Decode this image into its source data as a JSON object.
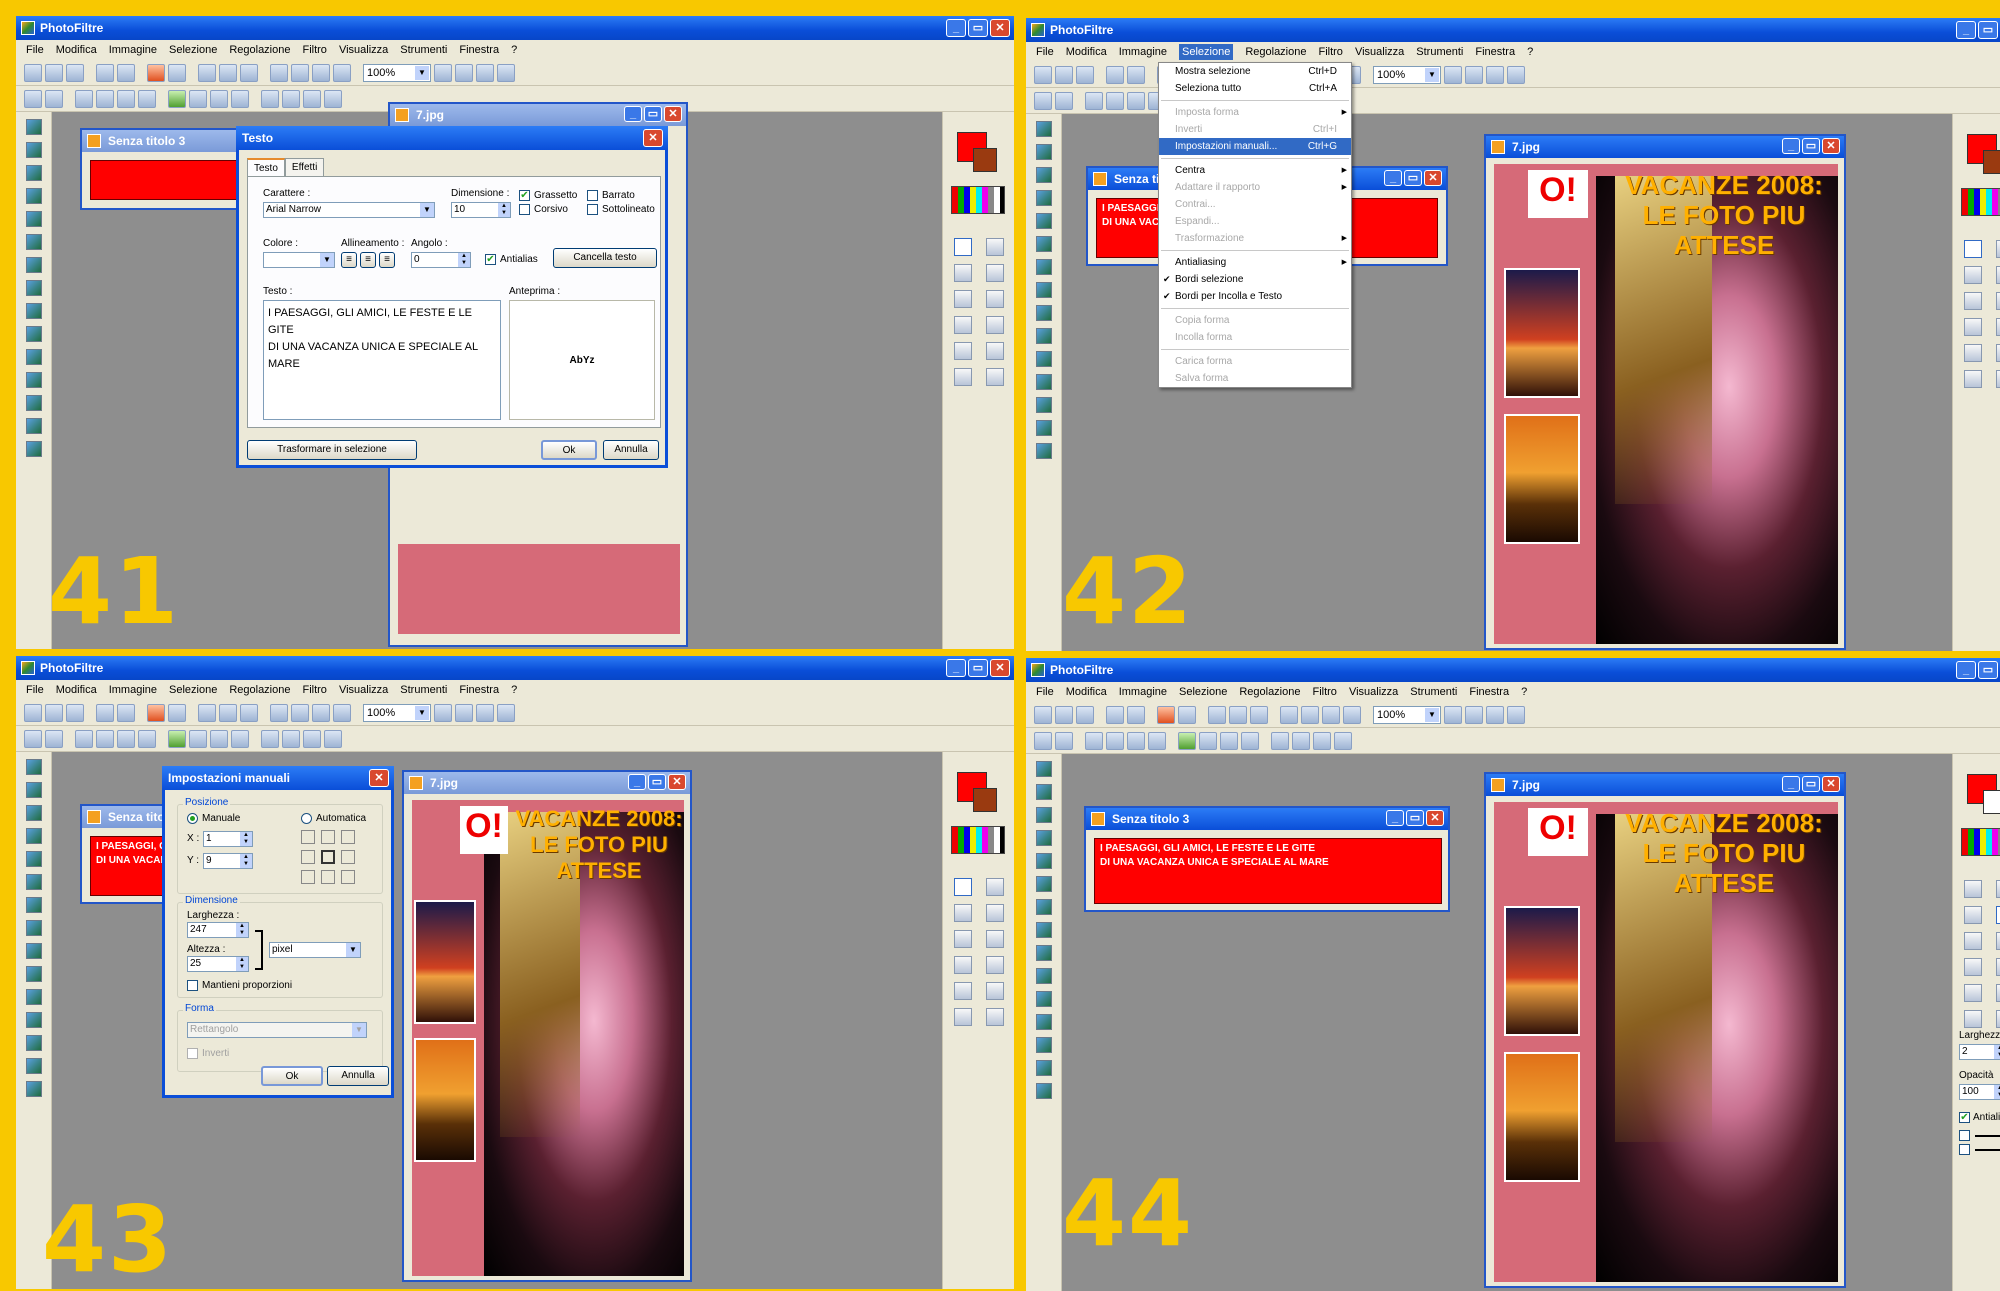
{
  "app": {
    "title": "PhotoFiltre",
    "zoom": "100%"
  },
  "menu": [
    "File",
    "Modifica",
    "Immagine",
    "Selezione",
    "Regolazione",
    "Filtro",
    "Visualizza",
    "Strumenti",
    "Finestra",
    "?"
  ],
  "windows": {
    "image": "7.jpg",
    "untitled": "Senza titolo 3"
  },
  "step_numbers": [
    "41",
    "42",
    "43",
    "44"
  ],
  "image_content": {
    "headline1": "VACANZE 2008:",
    "headline2": "LE FOTO PIU ATTESE",
    "badge": "O!"
  },
  "text_lines": [
    "I PAESAGGI, GLI AMICI, LE FESTE E LE GITE",
    "DI UNA VACANZA UNICA E SPECIALE AL MARE"
  ],
  "truncated_lines": [
    "I PAESAGGI, GLI AMI",
    "DI UNA VACANZA UNI"
  ],
  "truncated_lines_42": [
    "I PAESAGGI",
    "DI UNA VAC"
  ],
  "text_dialog": {
    "title": "Testo",
    "tabs": [
      "Testo",
      "Effetti"
    ],
    "font_label": "Carattere :",
    "font": "Arial Narrow",
    "size_label": "Dimensione :",
    "size": "10",
    "bold": "Grassetto",
    "italic": "Corsivo",
    "strike": "Barrato",
    "underline": "Sottolineato",
    "color_label": "Colore :",
    "align_label": "Allineamento :",
    "angle_label": "Angolo :",
    "angle": "0",
    "antialias": "Antialias",
    "clear": "Cancella testo",
    "text_label": "Testo :",
    "preview_label": "Anteprima :",
    "preview": "AbYz",
    "to_selection": "Trasformare in selezione",
    "ok": "Ok",
    "cancel": "Annulla"
  },
  "selection_menu": [
    {
      "label": "Mostra selezione",
      "shortcut": "Ctrl+D",
      "state": "on"
    },
    {
      "label": "Seleziona tutto",
      "shortcut": "Ctrl+A",
      "state": "on"
    },
    {
      "sep": true
    },
    {
      "label": "Imposta forma",
      "shortcut": "",
      "state": "dis",
      "arrow": true
    },
    {
      "label": "Inverti",
      "shortcut": "Ctrl+I",
      "state": "dis"
    },
    {
      "label": "Impostazioni manuali...",
      "shortcut": "Ctrl+G",
      "state": "hl"
    },
    {
      "sep": true
    },
    {
      "label": "Centra",
      "shortcut": "",
      "state": "on",
      "arrow": true
    },
    {
      "label": "Adattare il rapporto",
      "shortcut": "",
      "state": "dis",
      "arrow": true
    },
    {
      "label": "Contrai...",
      "shortcut": "",
      "state": "dis"
    },
    {
      "label": "Espandi...",
      "shortcut": "",
      "state": "dis"
    },
    {
      "label": "Trasformazione",
      "shortcut": "",
      "state": "dis",
      "arrow": true
    },
    {
      "sep": true
    },
    {
      "label": "Antialiasing",
      "shortcut": "",
      "state": "on",
      "arrow": true
    },
    {
      "label": "Bordi selezione",
      "shortcut": "",
      "state": "chk"
    },
    {
      "label": "Bordi per Incolla e Testo",
      "shortcut": "",
      "state": "chk"
    },
    {
      "sep": true
    },
    {
      "label": "Copia forma",
      "shortcut": "",
      "state": "dis"
    },
    {
      "label": "Incolla forma",
      "shortcut": "",
      "state": "dis"
    },
    {
      "sep": true
    },
    {
      "label": "Carica forma",
      "shortcut": "",
      "state": "dis"
    },
    {
      "label": "Salva forma",
      "shortcut": "",
      "state": "dis"
    }
  ],
  "manual_dialog": {
    "title": "Impostazioni manuali",
    "position": "Posizione",
    "manual": "Manuale",
    "auto": "Automatica",
    "x_label": "X :",
    "x": "1",
    "y_label": "Y :",
    "y": "9",
    "dimension": "Dimensione",
    "width_label": "Larghezza :",
    "width": "247",
    "height_label": "Altezza :",
    "height": "25",
    "unit": "pixel",
    "keep": "Mantieni proporzioni",
    "shape": "Forma",
    "shape_value": "Rettangolo",
    "invert": "Inverti",
    "ok": "Ok",
    "cancel": "Annulla"
  },
  "line_tool": {
    "width_label": "Larghezza",
    "width": "2",
    "opacity_label": "Opacità",
    "opacity": "100",
    "antialias": "Antialias"
  }
}
